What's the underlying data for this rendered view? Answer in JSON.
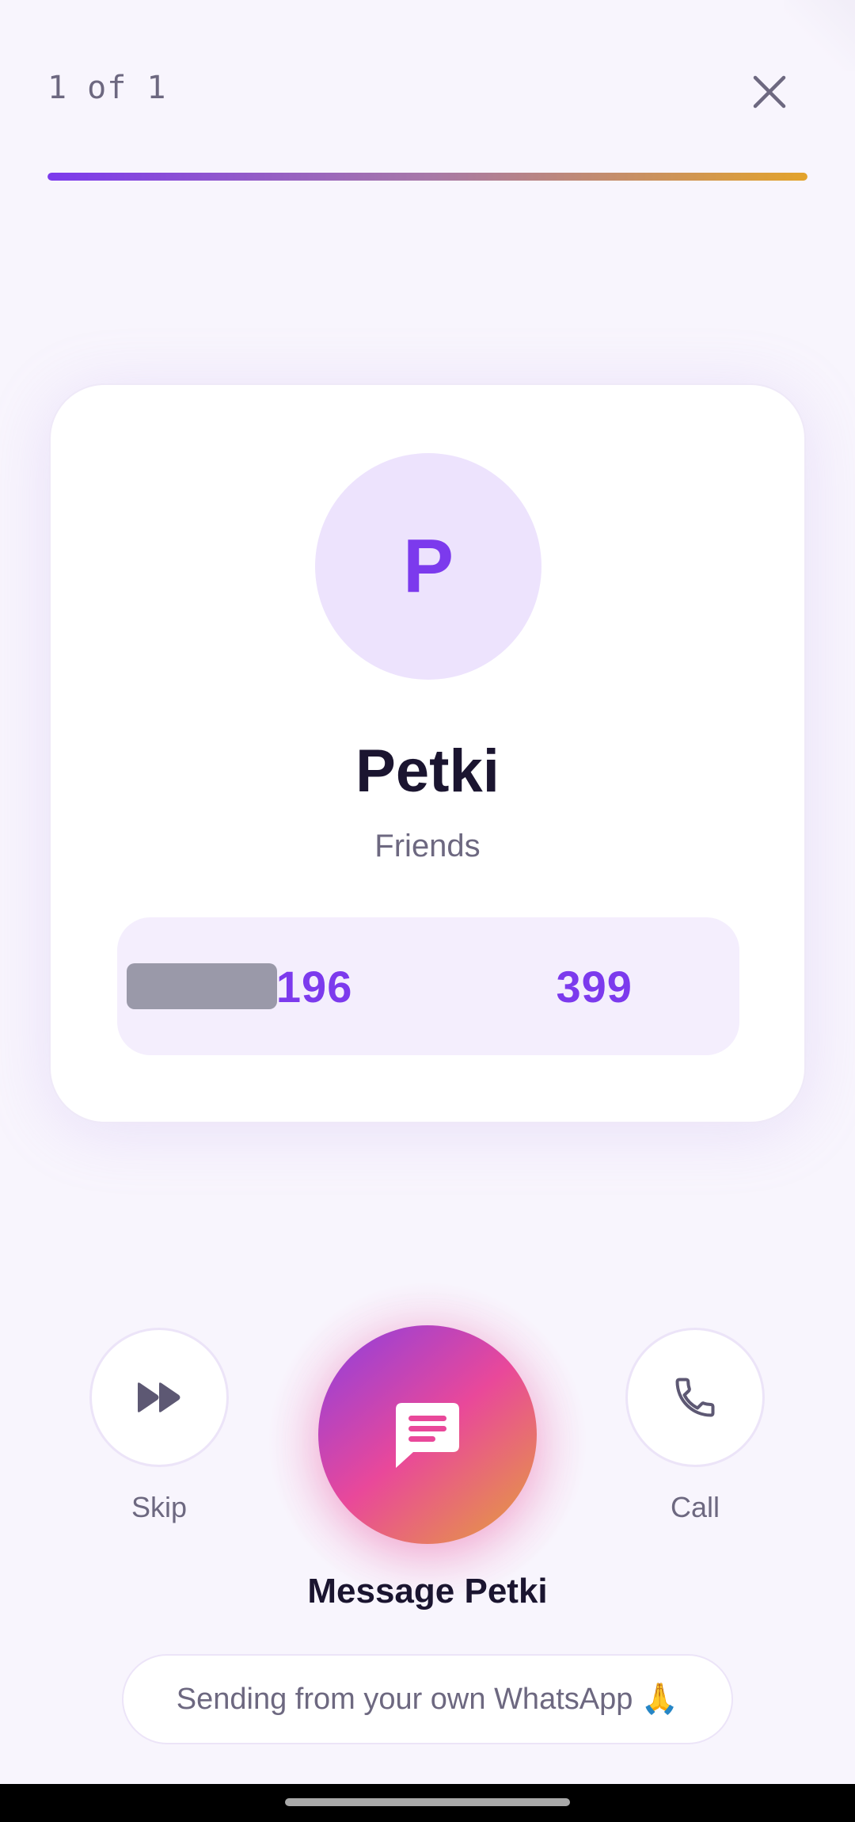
{
  "header": {
    "counter_text": "1 of 1",
    "close_icon": "close-icon",
    "progress_fraction": 1.0,
    "progress_colors": [
      "#7c3aed",
      "#a778a8",
      "#e3a32b"
    ]
  },
  "contact": {
    "avatar_initial": "P",
    "name": "Petki",
    "group": "Friends",
    "phone_display": "+9196        399"
  },
  "actions": {
    "skip_label": "Skip",
    "skip_icon": "fast-forward-icon",
    "call_label": "Call",
    "call_icon": "phone-icon",
    "message_label": "Message Petki",
    "message_icon": "chat-message-icon"
  },
  "footer": {
    "info_text": "Sending from your own WhatsApp 🙏"
  },
  "colors": {
    "accent": "#7c3aed",
    "pink": "#e9489a",
    "amber": "#e5a13a",
    "text_dark": "#1b1530",
    "text_muted": "#6d6880"
  }
}
